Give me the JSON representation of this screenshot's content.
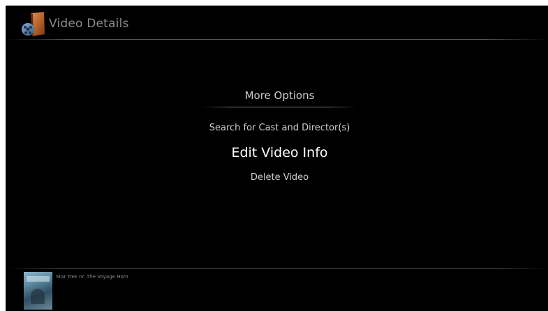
{
  "header": {
    "title": "Video Details",
    "icon": "video-library-icon"
  },
  "menu": {
    "title": "More Options",
    "items": [
      {
        "label": "Search for Cast and Director(s)",
        "selected": false
      },
      {
        "label": "Edit Video Info",
        "selected": true
      },
      {
        "label": "Delete Video",
        "selected": false
      }
    ]
  },
  "footer": {
    "video_title": "Star Trek IV: The Voyage Hom",
    "thumbnail": "video-poster-thumbnail"
  },
  "colors": {
    "background": "#000000",
    "text": "#cfcfcf",
    "selected_text": "#ffffff",
    "header_text": "#8c8c8c"
  }
}
